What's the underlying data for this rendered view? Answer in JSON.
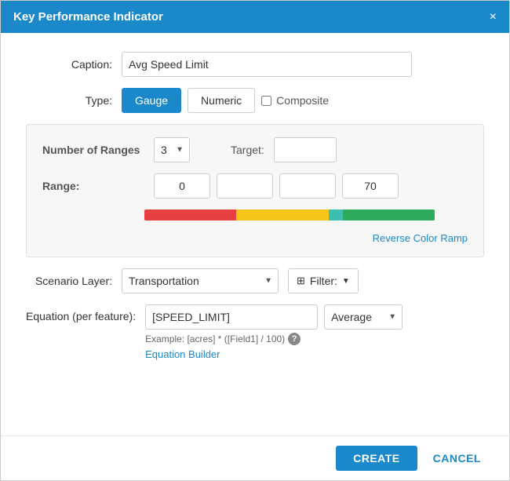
{
  "modal": {
    "title": "Key Performance Indicator",
    "close_icon": "×"
  },
  "form": {
    "caption_label": "Caption:",
    "caption_value": "Avg Speed Limit",
    "caption_placeholder": "",
    "type_label": "Type:",
    "type_gauge_label": "Gauge",
    "type_numeric_label": "Numeric",
    "type_composite_label": "Composite",
    "gauge_section": {
      "num_ranges_label": "Number of Ranges",
      "num_ranges_value": "3",
      "target_label": "Target:",
      "range_label": "Range:",
      "range_val1": "0",
      "range_val2": "",
      "range_val3": "",
      "range_val4": "70",
      "reverse_color_label": "Reverse Color Ramp"
    },
    "scenario_label": "Scenario Layer:",
    "scenario_value": "Transportation",
    "filter_label": "Filter:",
    "equation_label": "Equation (per feature):",
    "equation_value": "[SPEED_LIMIT]",
    "equation_hint": "Example: [acres] * ([Field1] / 100)",
    "equation_builder_label": "Equation Builder",
    "aggregation_value": "Average"
  },
  "footer": {
    "create_label": "CREATE",
    "cancel_label": "CANCEL"
  }
}
